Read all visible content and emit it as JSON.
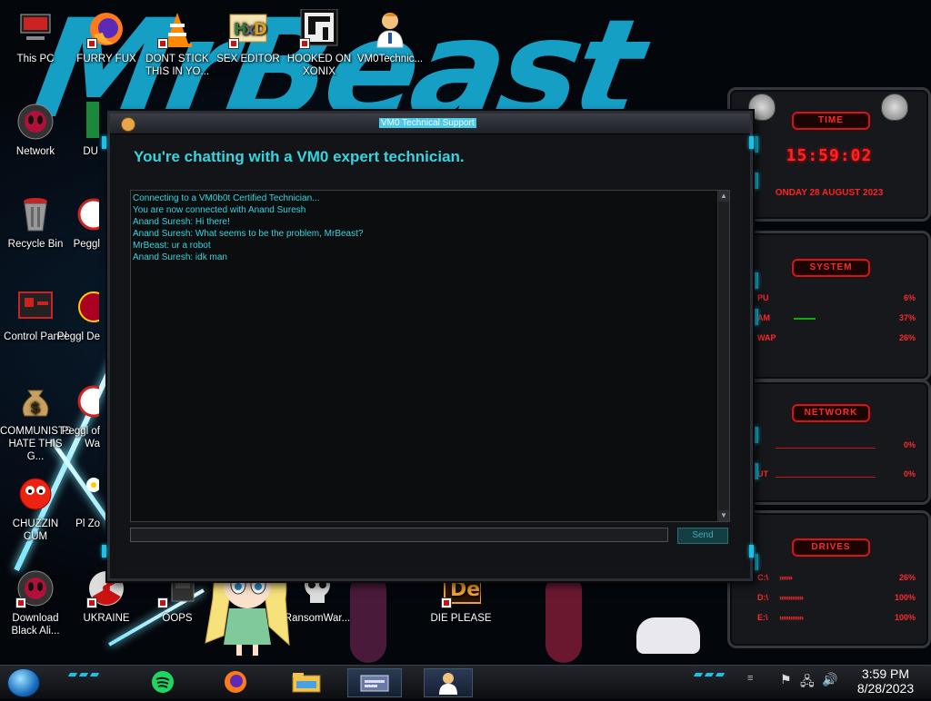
{
  "desktop_icons": [
    {
      "label": "This PC",
      "icon": "computer-icon"
    },
    {
      "label": "FURRY FUX",
      "icon": "firefox-icon"
    },
    {
      "label": "DONT STICK THIS IN YO...",
      "icon": "vlc-cone-icon"
    },
    {
      "label": "SEX EDITOR",
      "icon": "hxd-editor-icon"
    },
    {
      "label": "HOOKED ON XONIX",
      "icon": "xonix-game-icon"
    },
    {
      "label": "VM0Technic...",
      "icon": "technician-icon"
    },
    {
      "label": "Network",
      "icon": "network-alien-icon"
    },
    {
      "label": "DU",
      "icon": "partial-icon"
    },
    {
      "label": "Recycle Bin",
      "icon": "recycle-bin-icon"
    },
    {
      "label": "Peggl",
      "icon": "peggle-icon"
    },
    {
      "label": "Control Panel",
      "icon": "control-panel-icon"
    },
    {
      "label": "Peggl De",
      "icon": "peggle-icon"
    },
    {
      "label": "COMMUNISTS HATE THIS G...",
      "icon": "money-bag-icon"
    },
    {
      "label": "Peggl of Wa",
      "icon": "peggle-icon"
    },
    {
      "label": "CHUZZIN CUM",
      "icon": "chuzzle-icon"
    },
    {
      "label": "Pl Zo",
      "icon": "flower-icon"
    },
    {
      "label": "Download Black Ali...",
      "icon": "alien-download-icon"
    },
    {
      "label": "UKRAINE",
      "icon": "radiation-icon"
    },
    {
      "label": "OOPS",
      "icon": "oops-icon"
    },
    {
      "label": "RansomWar...",
      "icon": "skull-icon"
    },
    {
      "label": "DIE PLEASE",
      "icon": "adobe-de-icon"
    }
  ],
  "chat_window": {
    "title": "VM0 Technical Support",
    "heading": "You're chatting with a VM0 expert technician.",
    "messages": [
      "Connecting to a VM0b0t Certified Technician...",
      "You are now connected with Anand Suresh",
      "Anand Suresh: Hi there!",
      "Anand Suresh: What seems to be the problem, MrBeast?",
      "MrBeast: ur a robot",
      "Anand Suresh: idk man"
    ],
    "input_value": "",
    "send_label": "Send"
  },
  "gadgets": {
    "time": {
      "tab": "TIME",
      "clock": "15:59:02",
      "date": "ONDAY 28 AUGUST 2023"
    },
    "system": {
      "tab": "SYSTEM",
      "rows": [
        {
          "key": "PU",
          "value": "6%"
        },
        {
          "key": "AM",
          "value": "37%"
        },
        {
          "key": "WAP",
          "value": "26%"
        }
      ]
    },
    "network": {
      "tab": "NETWORK",
      "rows": [
        {
          "key": "",
          "value": "0%"
        },
        {
          "key": "UT",
          "value": "0%"
        }
      ]
    },
    "drives": {
      "tab": "DRIVES",
      "rows": [
        {
          "key": "C:\\",
          "value": "26%"
        },
        {
          "key": "D:\\",
          "value": "100%"
        },
        {
          "key": "E:\\",
          "value": "100%"
        }
      ]
    }
  },
  "wallpaper": {
    "text": "MrBeast"
  },
  "taskbar": {
    "apps": [
      {
        "name": "spotify-icon"
      },
      {
        "name": "firefox-icon"
      },
      {
        "name": "file-explorer-icon"
      },
      {
        "name": "window-app-icon"
      },
      {
        "name": "technician-icon"
      }
    ],
    "clock_time": "3:59 PM",
    "clock_date": "8/28/2023"
  },
  "colors": {
    "accent_cyan": "#35d5e0",
    "gadget_red": "#ff2222"
  }
}
